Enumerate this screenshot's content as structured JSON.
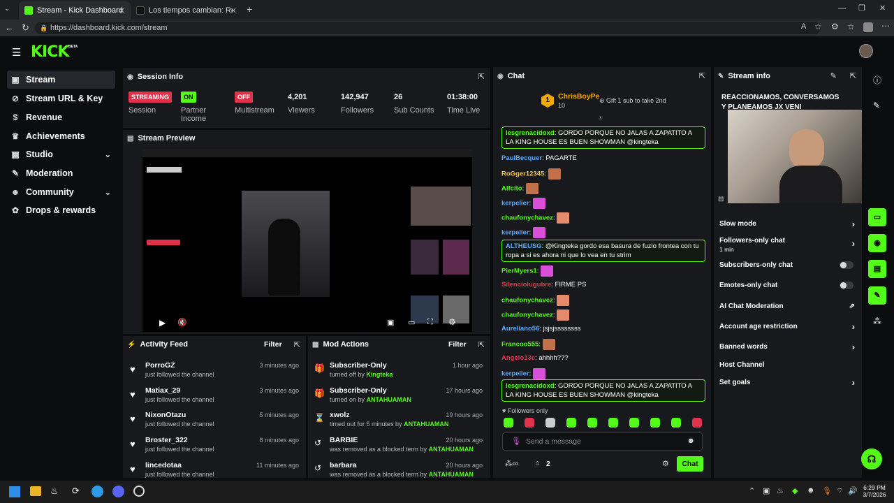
{
  "browser": {
    "tabs": [
      {
        "label": "Stream - Kick Dashboard"
      },
      {
        "label": "Los tiempos cambian: Reflexiones"
      }
    ],
    "url": "https://dashboard.kick.com/stream"
  },
  "header": {
    "logo": "KICK",
    "beta": "BETA"
  },
  "sidebar": {
    "items": [
      {
        "label": "Stream",
        "icon": "video-icon"
      },
      {
        "label": "Stream URL & Key",
        "icon": "link-icon"
      },
      {
        "label": "Revenue",
        "icon": "dollar-icon"
      },
      {
        "label": "Achievements",
        "icon": "trophy-icon"
      },
      {
        "label": "Studio",
        "icon": "grid-icon"
      },
      {
        "label": "Moderation",
        "icon": "wrench-icon"
      },
      {
        "label": "Community",
        "icon": "people-icon"
      },
      {
        "label": "Drops & rewards",
        "icon": "gift-icon"
      }
    ]
  },
  "session": {
    "title": "Session Info",
    "stats": [
      {
        "value": "STREAMING",
        "label": "Session"
      },
      {
        "value": "ON",
        "label": "Partner Income"
      },
      {
        "value": "OFF",
        "label": "Multistream"
      },
      {
        "value": "4,201",
        "label": "Viewers"
      },
      {
        "value": "142,947",
        "label": "Followers"
      },
      {
        "value": "26",
        "label": "Sub Counts"
      },
      {
        "value": "01:38:00",
        "label": "Time Live"
      }
    ]
  },
  "preview": {
    "title": "Stream Preview"
  },
  "activity": {
    "title": "Activity Feed",
    "filter": "Filter",
    "items": [
      {
        "name": "PorroGZ",
        "action": "just followed the channel",
        "time": "3 minutes ago"
      },
      {
        "name": "Matiax_29",
        "action": "just followed the channel",
        "time": "3 minutes ago"
      },
      {
        "name": "NixonOtazu",
        "action": "just followed the channel",
        "time": "5 minutes ago"
      },
      {
        "name": "Broster_322",
        "action": "just followed the channel",
        "time": "8 minutes ago"
      },
      {
        "name": "lincedotaa",
        "action": "just followed the channel",
        "time": "11 minutes ago"
      }
    ]
  },
  "mod": {
    "title": "Mod Actions",
    "filter": "Filter",
    "items": [
      {
        "name": "Subscriber-Only",
        "action": "turned off by",
        "by": "Kingteka",
        "time": "1 hour ago",
        "icon": "gift-icon"
      },
      {
        "name": "Subscriber-Only",
        "action": "turned on by",
        "by": "ANTAHUAMAN",
        "time": "17 hours ago",
        "icon": "gift-icon"
      },
      {
        "name": "xwolz",
        "action": "timed out for 5 minutes by",
        "by": "ANTAHUAMAN",
        "time": "19 hours ago",
        "icon": "hourglass-icon"
      },
      {
        "name": "BARBIE",
        "action": "was removed as a blocked term by",
        "by": "ANTAHUAMAN",
        "time": "20 hours ago",
        "icon": "undo-icon"
      },
      {
        "name": "barbara",
        "action": "was removed as a blocked term by",
        "by": "ANTAHUAMAN",
        "time": "20 hours ago",
        "icon": "undo-icon"
      }
    ]
  },
  "chat": {
    "title": "Chat",
    "top_gifter": {
      "name": "ChrisBoyPe",
      "count": "10",
      "rank": "1",
      "note": "Gift 1 sub to take 2nd"
    },
    "messages": [
      {
        "user": "lesgrenacidoxd",
        "color": "#53fc18",
        "text": "GORDO PORQUE NO JALAS A ZAPATITO A LA KING HOUSE ES BUEN SHOWMAN @kingteka",
        "highlight": true
      },
      {
        "user": "PaulBecquer",
        "color": "#5aa9ff",
        "text": "PAGARTE"
      },
      {
        "user": "RoGger12345",
        "color": "#f2c94c",
        "text": "",
        "emote": "#c0704a"
      },
      {
        "user": "Alfcito",
        "color": "#53fc18",
        "text": "",
        "emote": "#c0704a"
      },
      {
        "user": "kerpelier",
        "color": "#5aa9ff",
        "text": "",
        "emote": "#d94fd9"
      },
      {
        "user": "chaufonychavez",
        "color": "#53fc18",
        "text": "",
        "emote": "#e58a6a"
      },
      {
        "user": "kerpelier",
        "color": "#5aa9ff",
        "text": "",
        "emote": "#d94fd9"
      },
      {
        "user": "ALTHEUSG",
        "color": "#5aa9ff",
        "text": "@Kingteka gordo esa basura de fuzio frontea con tu ropa a si es ahora ni que lo vea en tu strim",
        "highlight": true
      },
      {
        "user": "PierMyers1",
        "color": "#53fc18",
        "text": "",
        "emote": "#d94fd9"
      },
      {
        "user": "Silenciolugubre",
        "color": "#e0334b",
        "text": "FIRME PS"
      },
      {
        "user": "chaufonychavez",
        "color": "#53fc18",
        "text": "",
        "emote": "#e58a6a"
      },
      {
        "user": "chaufonychavez",
        "color": "#53fc18",
        "text": "",
        "emote": "#e58a6a"
      },
      {
        "user": "Aureliano56",
        "color": "#5aa9ff",
        "text": "jsjsjssssssss"
      },
      {
        "user": "Francoo555",
        "color": "#53fc18",
        "text": "",
        "emote": "#c0704a"
      },
      {
        "user": "Angelo13c",
        "color": "#e0334b",
        "text": "ahhhh???"
      },
      {
        "user": "kerpelier",
        "color": "#5aa9ff",
        "text": "",
        "emote": "#d94fd9"
      },
      {
        "user": "lesgrenacidoxd",
        "color": "#53fc18",
        "text": "GORDO PORQUE NO JALAS A ZAPATITO A LA KING HOUSE ES BUEN SHOWMAN @kingteka",
        "highlight": true
      }
    ],
    "followers_only": "Followers only",
    "input_placeholder": "Send a message",
    "count": "2",
    "send": "Chat"
  },
  "stream_info": {
    "title": "Stream info",
    "stream_title": "REACCIONAMOS, CONVERSAMOS Y PLANEAMOS JX VENI",
    "settings": [
      {
        "label": "Slow mode",
        "control": "arrow"
      },
      {
        "label": "Followers-only chat",
        "sub": "1 min",
        "control": "arrow"
      },
      {
        "label": "Subscribers-only chat",
        "control": "toggle"
      },
      {
        "label": "Emotes-only chat",
        "control": "toggle"
      },
      {
        "label": "AI Chat Moderation",
        "control": "external"
      },
      {
        "label": "Account age restriction",
        "control": "arrow"
      },
      {
        "label": "Banned words",
        "control": "arrow"
      },
      {
        "label": "Host Channel",
        "control": "none"
      },
      {
        "label": "Set goals",
        "control": "arrow"
      }
    ]
  },
  "taskbar": {
    "time": "6:29 PM",
    "date": "3/7/2026"
  },
  "colors": {
    "accent": "#53fc18",
    "panel": "#18191c",
    "bg": "#0b0c0d",
    "red": "#e0334b"
  }
}
